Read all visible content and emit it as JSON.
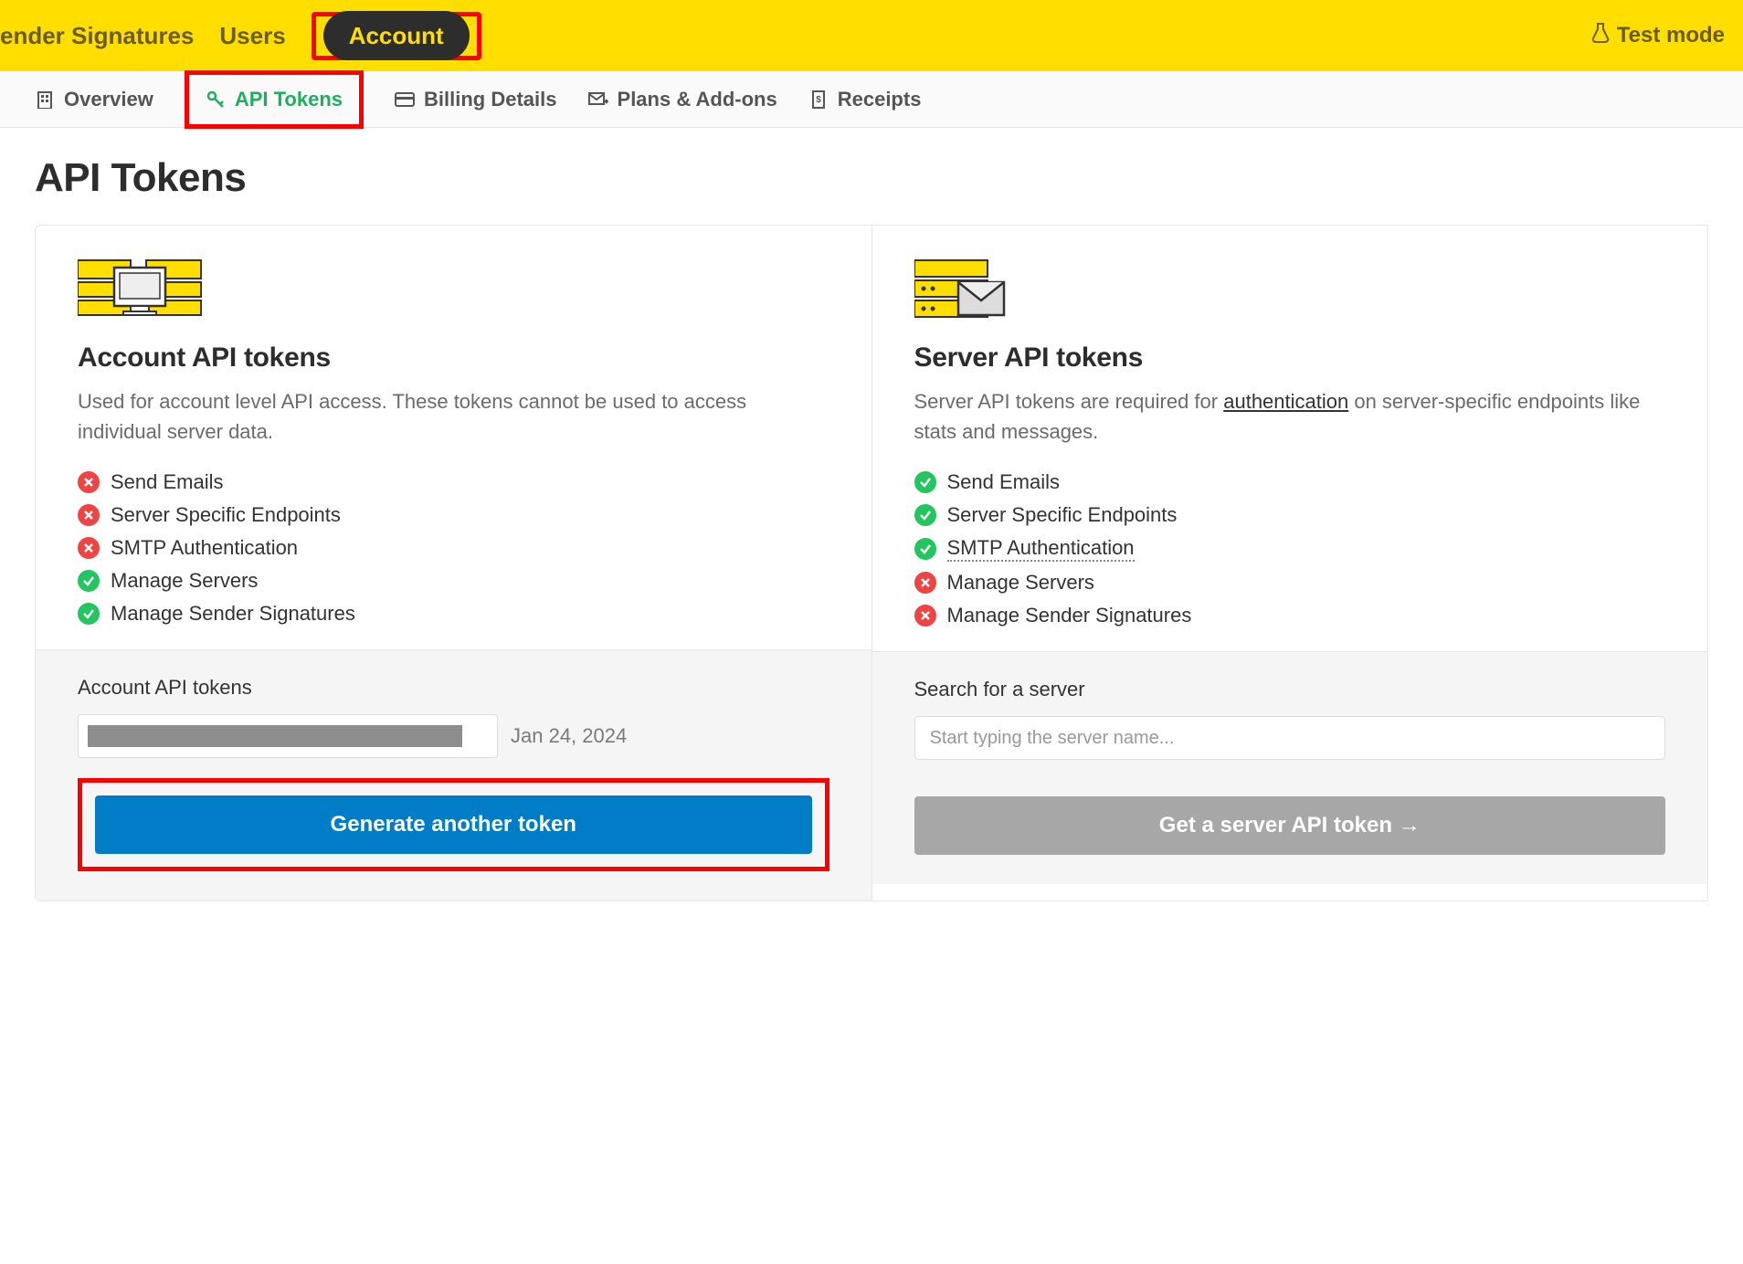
{
  "topNav": {
    "items": [
      "ender Signatures",
      "Users"
    ],
    "activePill": "Account",
    "testMode": "Test mode"
  },
  "subNav": {
    "items": [
      {
        "label": "Overview",
        "icon": "building"
      },
      {
        "label": "API Tokens",
        "icon": "key",
        "active": true
      },
      {
        "label": "Billing Details",
        "icon": "card"
      },
      {
        "label": "Plans & Add-ons",
        "icon": "envelope"
      },
      {
        "label": "Receipts",
        "icon": "receipt"
      }
    ]
  },
  "page": {
    "title": "API Tokens"
  },
  "accountCard": {
    "title": "Account API tokens",
    "description": "Used for account level API access. These tokens cannot be used to access individual server data.",
    "features": [
      {
        "ok": false,
        "label": "Send Emails"
      },
      {
        "ok": false,
        "label": "Server Specific Endpoints"
      },
      {
        "ok": false,
        "label": "SMTP Authentication"
      },
      {
        "ok": true,
        "label": "Manage Servers"
      },
      {
        "ok": true,
        "label": "Manage Sender Signatures"
      }
    ],
    "bottomLabel": "Account API tokens",
    "tokenDate": "Jan 24, 2024",
    "generateButton": "Generate another token"
  },
  "serverCard": {
    "title": "Server API tokens",
    "descriptionPrefix": "Server API tokens are required for ",
    "descriptionLink": "authentication",
    "descriptionSuffix": " on server-specific endpoints like stats and messages.",
    "features": [
      {
        "ok": true,
        "label": "Send Emails"
      },
      {
        "ok": true,
        "label": "Server Specific Endpoints"
      },
      {
        "ok": true,
        "label": "SMTP Authentication",
        "dotted": true
      },
      {
        "ok": false,
        "label": "Manage Servers"
      },
      {
        "ok": false,
        "label": "Manage Sender Signatures"
      }
    ],
    "bottomLabel": "Search for a server",
    "searchPlaceholder": "Start typing the server name...",
    "getTokenButton": "Get a server API token →"
  }
}
